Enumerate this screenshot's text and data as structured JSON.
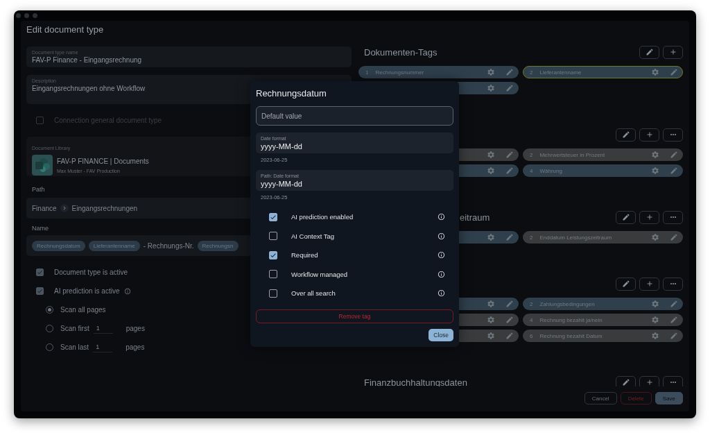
{
  "window": {
    "title": "Edit document type"
  },
  "form": {
    "fields": [
      {
        "label": "Document type name",
        "value": "FAV-P Finance - Eingangsrechnung",
        "kind": "single"
      },
      {
        "label": "Description",
        "value": "Eingangsrechnungen ohne Workflow",
        "kind": "multi"
      }
    ],
    "connection": {
      "label": "Connection general document type",
      "checked": false,
      "disabled": true
    },
    "library": {
      "label": "Document Library",
      "name": "FAV-P FINANCE | Documents",
      "owner": "Max Muster - FAV Production"
    },
    "path": {
      "label": "Path",
      "segments": [
        "Finance",
        "Eingangsrechnungen"
      ]
    },
    "name": {
      "label": "Name",
      "parts": [
        {
          "kind": "tag",
          "text": "Rechnungsdatum"
        },
        {
          "kind": "tag",
          "text": "Lieferantenname"
        },
        {
          "kind": "text",
          "text": "- Rechnungs-Nr."
        },
        {
          "kind": "tag",
          "text": "Rechnungsn"
        }
      ]
    },
    "options": [
      {
        "label": "Document type is active",
        "checked": true,
        "info": false
      },
      {
        "label": "AI prediction is active",
        "checked": true,
        "info": true
      }
    ],
    "scan": [
      {
        "label": "Scan all pages",
        "selected": true
      },
      {
        "label": "Scan first",
        "value": "1",
        "suffix": "pages",
        "selected": false
      },
      {
        "label": "Scan last",
        "value": "1",
        "suffix": "pages",
        "selected": false
      }
    ]
  },
  "tag_groups": [
    {
      "title": "Dokumenten-Tags",
      "buttons": [
        {
          "kind": "edit"
        },
        {
          "kind": "add"
        }
      ],
      "tags": [
        {
          "number": "1",
          "label": "Rechnungsnummer",
          "color": "#2f3f4c",
          "selected": false
        },
        {
          "number": "2",
          "label": "Lieferantenname",
          "color": "#2f3f4c",
          "selected": true
        },
        {
          "covered": true,
          "color": "#2f3f4c",
          "selected": false
        }
      ]
    },
    {
      "buttons": [
        {
          "kind": "edit"
        },
        {
          "kind": "add"
        },
        {
          "kind": "more"
        }
      ],
      "tags": [
        {
          "covered": true,
          "color": "#3a3b3d",
          "selected": false
        },
        {
          "number": "2",
          "label": "Mehrwertsteuer in Prozent",
          "color": "#3a3b3d",
          "selected": false
        },
        {
          "covered": true,
          "color": "#2f3f4c",
          "selected": false
        },
        {
          "number": "4",
          "label": "Währung",
          "color": "#2f3f4c",
          "selected": false
        }
      ]
    },
    {
      "title": "eitraum",
      "title_covered": true,
      "buttons": [
        {
          "kind": "edit"
        },
        {
          "kind": "add"
        },
        {
          "kind": "more"
        }
      ],
      "tags": [
        {
          "covered": true,
          "color": "#2f3f4c",
          "selected": false
        },
        {
          "number": "2",
          "label": "Enddatum Leistungszeitraum",
          "color": "#3a3b3d",
          "selected": false
        }
      ]
    },
    {
      "buttons": [
        {
          "kind": "edit"
        },
        {
          "kind": "add"
        },
        {
          "kind": "more"
        }
      ],
      "tags": [
        {
          "covered": true,
          "color": "#2f3f4c",
          "selected": false
        },
        {
          "number": "2",
          "label": "Zahlungsbedingungen",
          "color": "#2f3f4c",
          "selected": false
        },
        {
          "covered": true,
          "color": "#3a3b3d",
          "selected": false
        },
        {
          "number": "4",
          "label": "Rechnung bezahlt ja/nein",
          "color": "#3a3b3d",
          "selected": false
        },
        {
          "covered": true,
          "color": "#3a3b3d",
          "selected": false
        },
        {
          "number": "6",
          "label": "Rechnung bezahlt Datum",
          "color": "#3a3b3d",
          "selected": false
        }
      ]
    },
    {
      "title": "Finanzbuchhaltungsdaten",
      "buttons": [
        {
          "kind": "edit"
        },
        {
          "kind": "add"
        },
        {
          "kind": "more"
        }
      ]
    }
  ],
  "footer": {
    "buttons": [
      {
        "label": "Cancel",
        "kind": "cancel"
      },
      {
        "label": "Delete",
        "kind": "delete"
      },
      {
        "label": "Save",
        "kind": "save"
      }
    ]
  },
  "dialog": {
    "title": "Rechnungsdatum",
    "default_field": {
      "placeholder": "Default value"
    },
    "formats": [
      {
        "label": "Date format",
        "value": "yyyy-MM-dd",
        "preview": "2023-06-25"
      },
      {
        "label": "Path: Date format",
        "value": "yyyy-MM-dd",
        "preview": "2023-06-25"
      }
    ],
    "options": [
      {
        "label": "AI prediction enabled",
        "checked": true
      },
      {
        "label": "AI Context Tag",
        "checked": false
      },
      {
        "label": "Required",
        "checked": true
      },
      {
        "label": "Workflow managed",
        "checked": false
      },
      {
        "label": "Over all search",
        "checked": false
      }
    ],
    "remove": "Remove tag",
    "close": "Close"
  }
}
